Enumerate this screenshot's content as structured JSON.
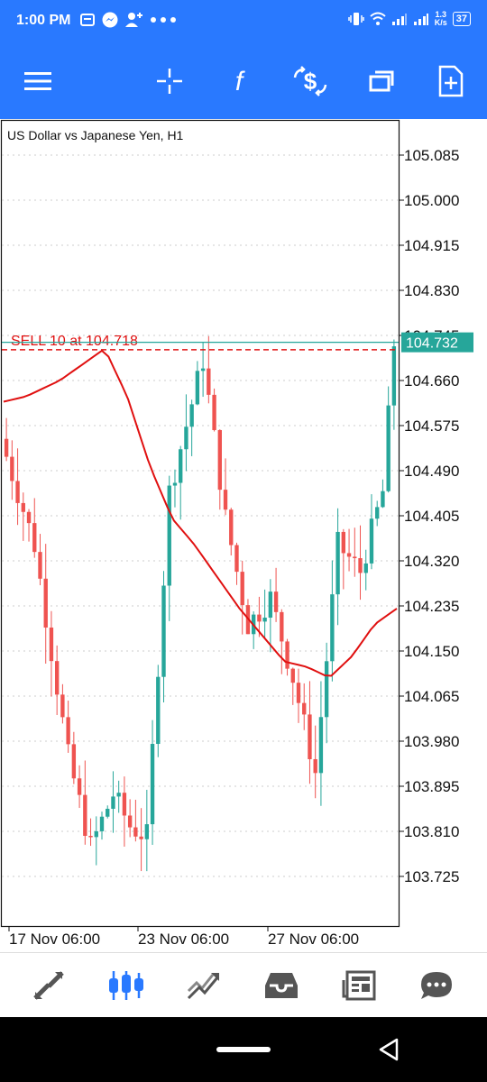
{
  "status_bar": {
    "time": "1:00 PM",
    "netspeed_value": "1.3",
    "netspeed_unit": "K/s",
    "battery": "37",
    "icons": [
      "sim-card-icon",
      "messenger-icon",
      "person-add-icon",
      "more-dots-icon",
      "vibrate-icon",
      "wifi-icon",
      "signal-icon",
      "signal-icon",
      "battery-icon"
    ]
  },
  "toolbar": {
    "icons": [
      "menu-icon",
      "crosshair-icon",
      "function-icon",
      "dollar-exchange-icon",
      "window-icon",
      "new-document-icon"
    ]
  },
  "chart": {
    "title": "US Dollar vs Japanese Yen, H1",
    "current_price": "104.732",
    "order_label": "SELL 10 at 104.718",
    "colors": {
      "bull": "#26a69a",
      "bear": "#ef5350",
      "ma": "#e01010",
      "order": "#e01010",
      "price_line": "#26a69a",
      "axis": "#111111"
    }
  },
  "chart_data": {
    "type": "candlestick",
    "title": "US Dollar vs Japanese Yen, H1",
    "symbol": "USDJPY",
    "timeframe": "H1",
    "y_ticks": [
      "105.085",
      "105.000",
      "104.915",
      "104.830",
      "104.745",
      "104.660",
      "104.575",
      "104.490",
      "104.405",
      "104.320",
      "104.235",
      "104.150",
      "104.065",
      "103.980",
      "103.895",
      "103.810",
      "103.725"
    ],
    "x_ticks": [
      "17 Nov 06:00",
      "23 Nov 06:00",
      "27 Nov 06:00"
    ],
    "ylim": [
      103.68,
      105.12
    ],
    "current_price": 104.732,
    "order": {
      "side": "SELL",
      "lots": 10,
      "price": 104.718
    },
    "path_t": [
      0,
      6,
      12,
      16,
      20,
      23,
      26,
      30,
      36,
      40,
      44,
      48,
      52,
      56,
      60,
      64,
      68,
      70
    ],
    "path_p": [
      104.55,
      104.35,
      103.95,
      103.78,
      103.88,
      103.82,
      103.8,
      104.45,
      104.7,
      104.4,
      104.2,
      104.25,
      104.1,
      103.92,
      104.35,
      104.3,
      104.45,
      104.73
    ],
    "ma_t": [
      0,
      4,
      10,
      14,
      18,
      22,
      26,
      30,
      34,
      38,
      42,
      46,
      50,
      54,
      58,
      62,
      66,
      70
    ],
    "ma_p": [
      104.62,
      104.63,
      104.66,
      104.69,
      104.72,
      104.63,
      104.5,
      104.4,
      104.35,
      104.29,
      104.23,
      104.18,
      104.13,
      104.12,
      104.1,
      104.14,
      104.2,
      104.23
    ],
    "n_candles": 70
  },
  "bottom_nav": {
    "items": [
      "quotes-icon",
      "chart-icon",
      "trade-icon",
      "history-icon",
      "news-icon",
      "messages-icon"
    ]
  }
}
